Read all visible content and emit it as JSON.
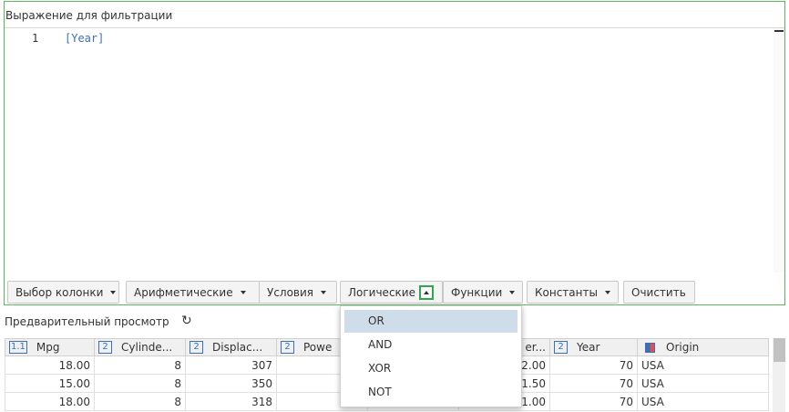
{
  "editor": {
    "title": "Выражение для фильтрации",
    "line_number": "1",
    "code": "[Year]"
  },
  "toolbar": {
    "column_select": "Выбор колонки",
    "arithmetic": "Арифметические",
    "conditions": "Условия",
    "logical": "Логические",
    "functions": "Функции",
    "constants": "Константы",
    "clear": "Очистить"
  },
  "preview": {
    "label": "Предварительный просмотр",
    "refresh_icon": "refresh-icon"
  },
  "grid": {
    "columns": [
      {
        "badge": "1.1",
        "label": "Mpg"
      },
      {
        "badge": "2",
        "label": "Cylinde..."
      },
      {
        "badge": "2",
        "label": "Displac..."
      },
      {
        "badge": "2",
        "label": "Powe"
      },
      {
        "badge": "",
        "label": ""
      },
      {
        "badge": "",
        "label": "er..."
      },
      {
        "badge": "2",
        "label": "Year"
      },
      {
        "badge": "",
        "label": "Origin"
      }
    ],
    "rows": [
      [
        "18.00",
        "8",
        "307",
        "",
        "",
        "2.00",
        "70",
        "USA"
      ],
      [
        "15.00",
        "8",
        "350",
        "",
        "",
        "1.50",
        "70",
        "USA"
      ],
      [
        "18.00",
        "8",
        "318",
        "",
        "",
        "1.00",
        "70",
        "USA"
      ]
    ]
  },
  "dropdown": {
    "items": [
      "OR",
      "AND",
      "XOR",
      "NOT"
    ],
    "active_index": 0
  },
  "colors": {
    "accent_green": "#2ea84a",
    "link_blue": "#3b6fb6",
    "selected_item": "#cfdcea"
  }
}
